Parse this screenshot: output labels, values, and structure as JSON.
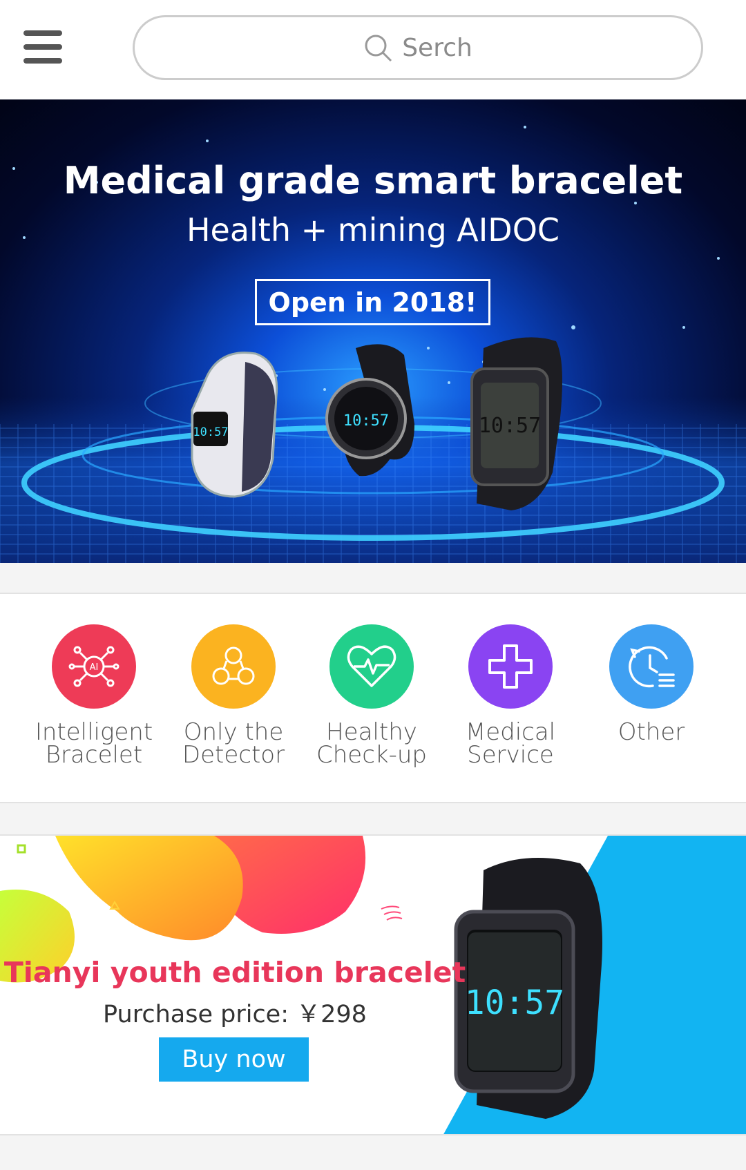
{
  "header": {
    "menu_icon": "hamburger-menu-icon",
    "search_placeholder": "Serch"
  },
  "hero": {
    "title": "Medical grade smart bracelet",
    "subtitle": "Health + mining AIDOC",
    "cta": "Open in 2018!",
    "device_time": "10:57"
  },
  "categories": [
    {
      "label_line1": "Intelligent",
      "label_line2": "Bracelet",
      "icon": "ai-network-icon",
      "color": "#ee3b57"
    },
    {
      "label_line1": "Only the",
      "label_line2": "Detector",
      "icon": "three-circles-icon",
      "color": "#fbb320"
    },
    {
      "label_line1": "Healthy",
      "label_line2": "Check-up",
      "icon": "heart-pulse-icon",
      "color": "#22cf8b"
    },
    {
      "label_line1": "Medical",
      "label_line2": "Service",
      "icon": "medical-cross-icon",
      "color": "#8a44f2"
    },
    {
      "label_line1": "Other",
      "label_line2": "",
      "icon": "clock-list-icon",
      "color": "#3fa0f2"
    }
  ],
  "promo": {
    "title": "Tianyi youth edition bracelet",
    "price": "Purchase price: ￥298",
    "button": "Buy now",
    "device_time": "10:57",
    "accent": "#e8365a",
    "button_color": "#15a9ee"
  }
}
